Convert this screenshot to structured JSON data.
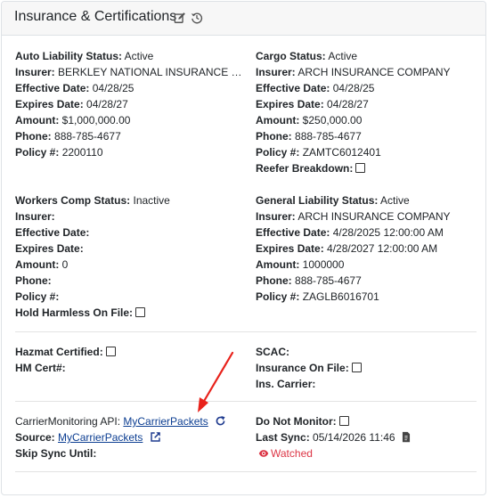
{
  "header": {
    "title": "Insurance & Certifications",
    "icons": [
      "edit-icon",
      "history-icon"
    ]
  },
  "auto": {
    "status_label": "Auto Liability Status:",
    "status": "Active",
    "insurer_label": "Insurer:",
    "insurer": "BERKLEY NATIONAL INSURANCE CO...",
    "effective_label": "Effective Date:",
    "effective": "04/28/25",
    "expires_label": "Expires Date:",
    "expires": "04/28/27",
    "amount_label": "Amount:",
    "amount": "$1,000,000.00",
    "phone_label": "Phone:",
    "phone": "888-785-4677",
    "policy_label": "Policy #:",
    "policy": "2200110"
  },
  "cargo": {
    "status_label": "Cargo Status:",
    "status": "Active",
    "insurer_label": "Insurer:",
    "insurer": "ARCH INSURANCE COMPANY",
    "effective_label": "Effective Date:",
    "effective": "04/28/25",
    "expires_label": "Expires Date:",
    "expires": "04/28/27",
    "amount_label": "Amount:",
    "amount": "$250,000.00",
    "phone_label": "Phone:",
    "phone": "888-785-4677",
    "policy_label": "Policy #:",
    "policy": "ZAMTC6012401",
    "reefer_label": "Reefer Breakdown:",
    "reefer_checked": false
  },
  "workers": {
    "status_label": "Workers Comp Status:",
    "status": "Inactive",
    "insurer_label": "Insurer:",
    "insurer": "",
    "effective_label": "Effective Date:",
    "effective": "",
    "expires_label": "Expires Date:",
    "expires": "",
    "amount_label": "Amount:",
    "amount": "0",
    "phone_label": "Phone:",
    "phone": "",
    "policy_label": "Policy #:",
    "policy": "",
    "hold_label": "Hold Harmless On File:",
    "hold_checked": false
  },
  "general": {
    "status_label": "General Liability Status:",
    "status": "Active",
    "insurer_label": "Insurer:",
    "insurer": "ARCH INSURANCE COMPANY",
    "effective_label": "Effective Date:",
    "effective": "4/28/2025 12:00:00 AM",
    "expires_label": "Expires Date:",
    "expires": "4/28/2027 12:00:00 AM",
    "amount_label": "Amount:",
    "amount": "1000000",
    "phone_label": "Phone:",
    "phone": "888-785-4677",
    "policy_label": "Policy #:",
    "policy": "ZAGLB6016701"
  },
  "hazmat": {
    "certified_label": "Hazmat Certified:",
    "certified_checked": false,
    "hm_cert_label": "HM Cert#:",
    "hm_cert": ""
  },
  "scac": {
    "scac_label": "SCAC:",
    "scac": "",
    "insurance_on_file_label": "Insurance On File:",
    "insurance_on_file_checked": false,
    "ins_carrier_label": "Ins. Carrier:",
    "ins_carrier": ""
  },
  "monitoring": {
    "api_label": "CarrierMonitoring API:",
    "api_link": "MyCarrierPackets",
    "source_label": "Source:",
    "source_link": "MyCarrierPackets",
    "skip_label": "Skip Sync Until:",
    "skip": "",
    "do_not_monitor_label": "Do Not Monitor:",
    "do_not_monitor_checked": false,
    "last_sync_label": "Last Sync:",
    "last_sync": "05/14/2026 11:46",
    "watched": "Watched"
  },
  "colors": {
    "link": "#0b3d91",
    "watched": "#dc3545",
    "arrow": "#e8221b",
    "header_bg": "#f7f7f7"
  }
}
